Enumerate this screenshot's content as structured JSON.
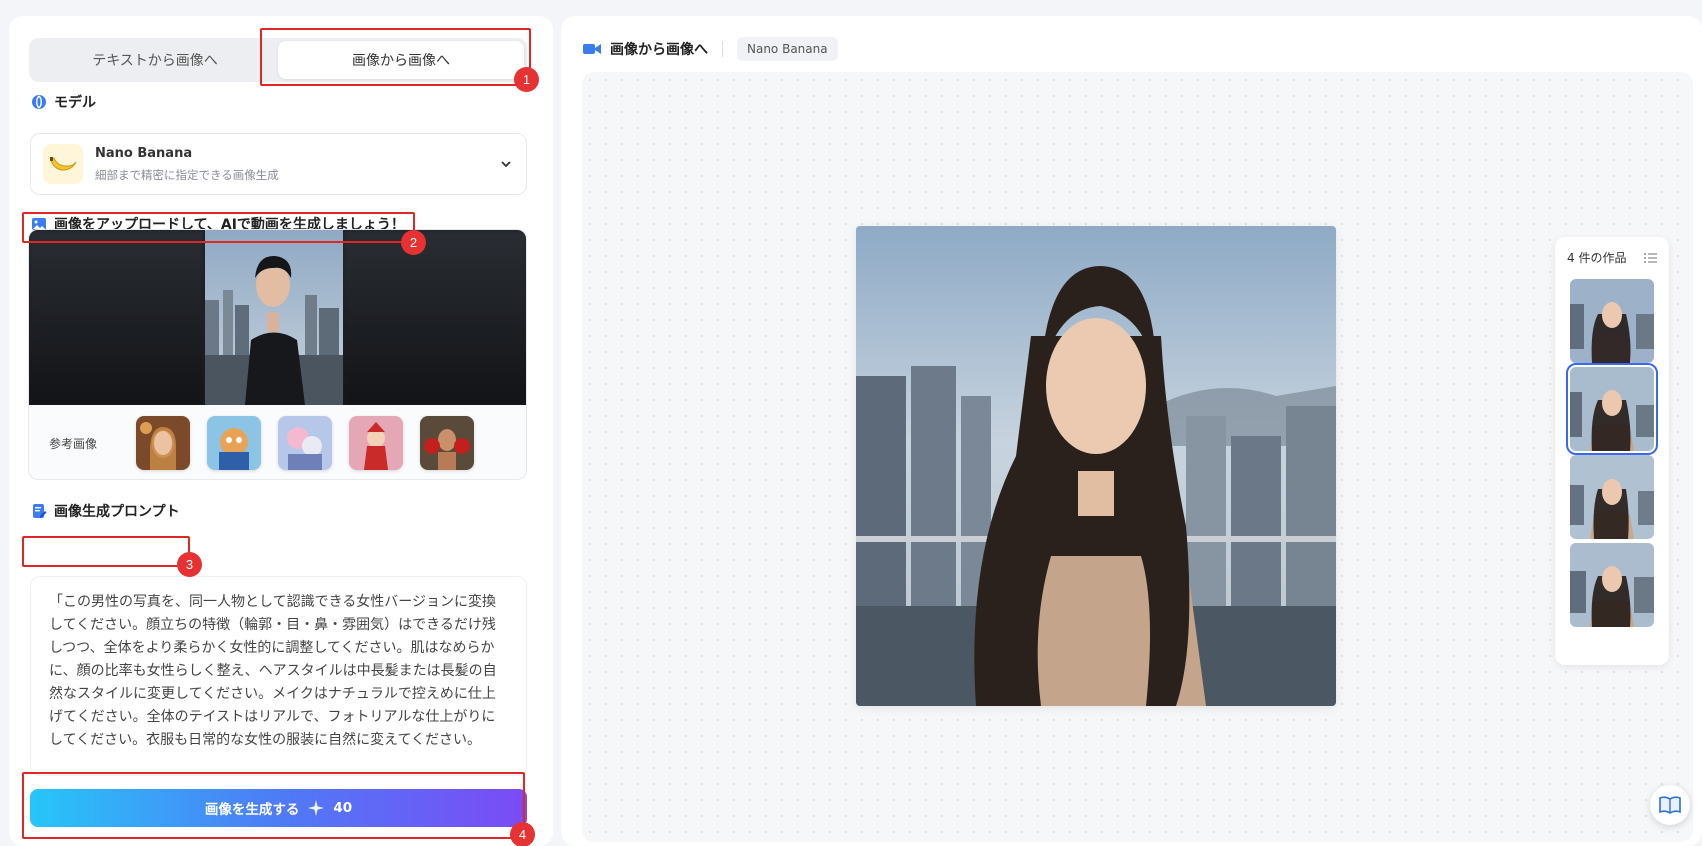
{
  "mode_tabs": {
    "text_to_image": "テキストから画像へ",
    "image_to_image": "画像から画像へ"
  },
  "model_section": {
    "title": "モデル",
    "model_name": "Nano Banana",
    "model_desc": "細部まで精密に指定できる画像生成"
  },
  "upload_section": {
    "title": "画像をアップロードして、AIで動画を生成しましょう！",
    "reference_label": "参考画像"
  },
  "prompt_section": {
    "title": "画像生成プロンプト",
    "text": "「この男性の写真を、同一人物として認識できる女性バージョンに変換してください。顔立ちの特徴（輪郭・目・鼻・雰囲気）はできるだけ残しつつ、全体をより柔らかく女性的に調整してください。肌はなめらかに、顔の比率も女性らしく整え、ヘアスタイルは中長髪または長髪の自然なスタイルに変更してください。メイクはナチュラルで控えめに仕上げてください。全体のテイストはリアルで、フォトリアルな仕上がりにしてください。衣服も日常的な女性の服装に自然に変えてください。"
  },
  "generate_button": {
    "label": "画像を生成する",
    "cost": "40"
  },
  "annotations": [
    "1",
    "2",
    "3",
    "4"
  ],
  "result_panel": {
    "title": "画像から画像へ",
    "model_chip": "Nano Banana",
    "works_count_label": "4 件の作品"
  },
  "colors": {
    "accent_blue": "#3d68ee",
    "annotation_red": "#e12626",
    "gradient_start": "#27c6f8",
    "gradient_end": "#7b4bf5"
  }
}
